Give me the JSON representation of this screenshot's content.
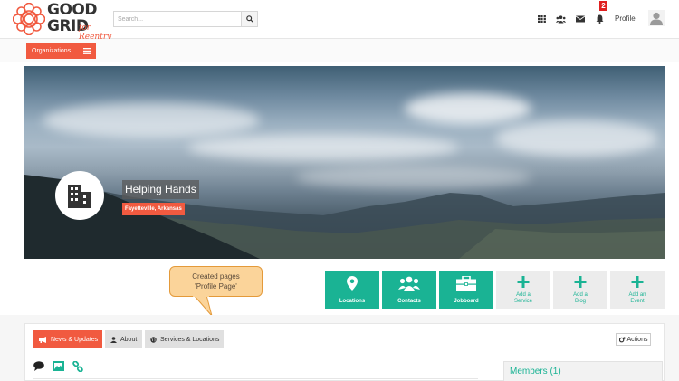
{
  "brand": {
    "line1": "GOOD",
    "line2": "GRID",
    "tagline": "for Reentry",
    "accent": "#f15a40",
    "teal": "#1ab394"
  },
  "search": {
    "placeholder": "Search..."
  },
  "header": {
    "notification_count": "2",
    "profile_label": "Profile",
    "icons": [
      "apps-grid-icon",
      "people-icon",
      "envelope-icon",
      "bell-icon",
      "user-avatar-icon"
    ]
  },
  "orgbar": {
    "label": "Organizations"
  },
  "org": {
    "name": "Helping Hands",
    "location": "Fayetteville, Arkansas"
  },
  "callout": {
    "line1": "Created pages",
    "line2": "'Profile Page'"
  },
  "tiles": [
    {
      "label": "Locations",
      "icon": "map-marker-icon",
      "style": "teal"
    },
    {
      "label": "Contacts",
      "icon": "group-icon",
      "style": "teal"
    },
    {
      "label": "Jobboard",
      "icon": "briefcase-icon",
      "style": "teal"
    },
    {
      "label1": "Add a",
      "label2": "Service",
      "icon": "plus-icon",
      "style": "gray"
    },
    {
      "label1": "Add a",
      "label2": "Blog",
      "icon": "plus-icon",
      "style": "gray"
    },
    {
      "label1": "Add an",
      "label2": "Event",
      "icon": "plus-icon",
      "style": "gray"
    }
  ],
  "tabs": {
    "news": "News & Updates",
    "about": "About",
    "services": "Services & Locations"
  },
  "actions_label": "Actions",
  "members_label": "Members (1)"
}
